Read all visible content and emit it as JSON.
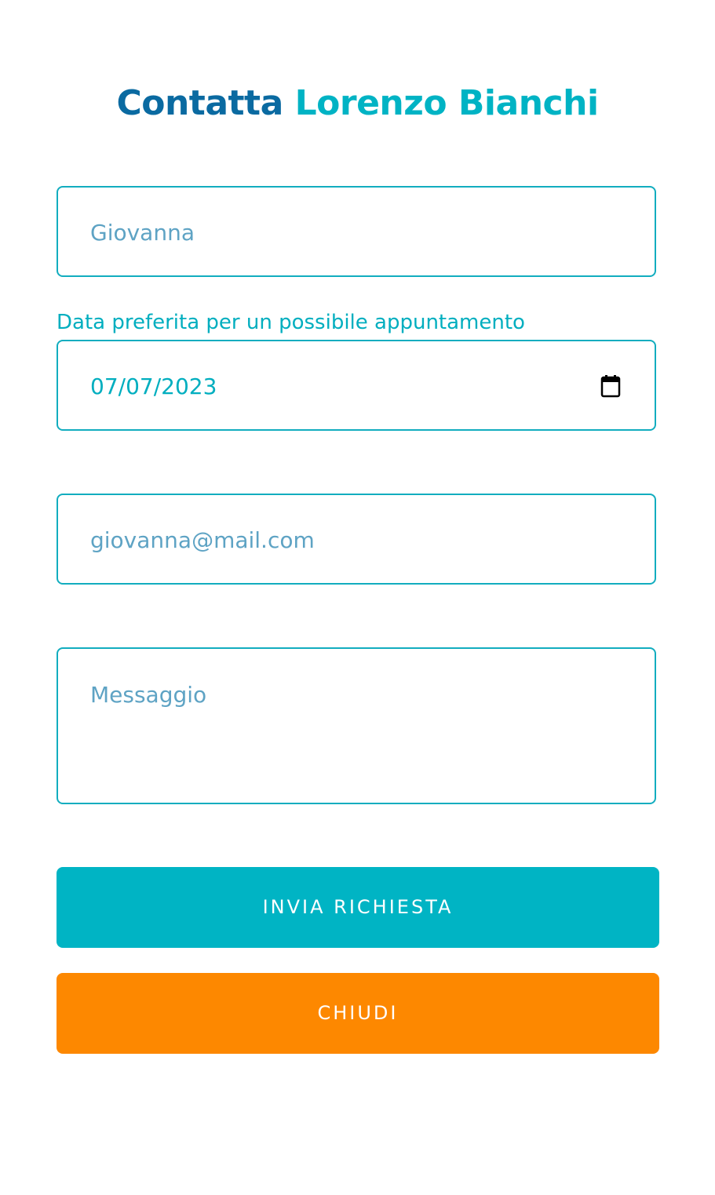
{
  "header": {
    "title_prefix": "Contatta",
    "title_name": "Lorenzo Bianchi"
  },
  "form": {
    "name": {
      "placeholder": "Giovanna"
    },
    "date": {
      "label": "Data preferita per un possibile appuntamento",
      "value": "07/07/2023",
      "icon": "calendar-icon"
    },
    "email": {
      "placeholder": "giovanna@mail.com"
    },
    "message": {
      "placeholder": "Messaggio"
    }
  },
  "actions": {
    "send_label": "INVIA RICHIESTA",
    "close_label": "CHIUDI"
  },
  "colors": {
    "title_primary": "#0a6aa1",
    "accent": "#00b4c4",
    "border": "#12adbf",
    "placeholder": "#5ea3c4",
    "close_button": "#fd8800"
  }
}
